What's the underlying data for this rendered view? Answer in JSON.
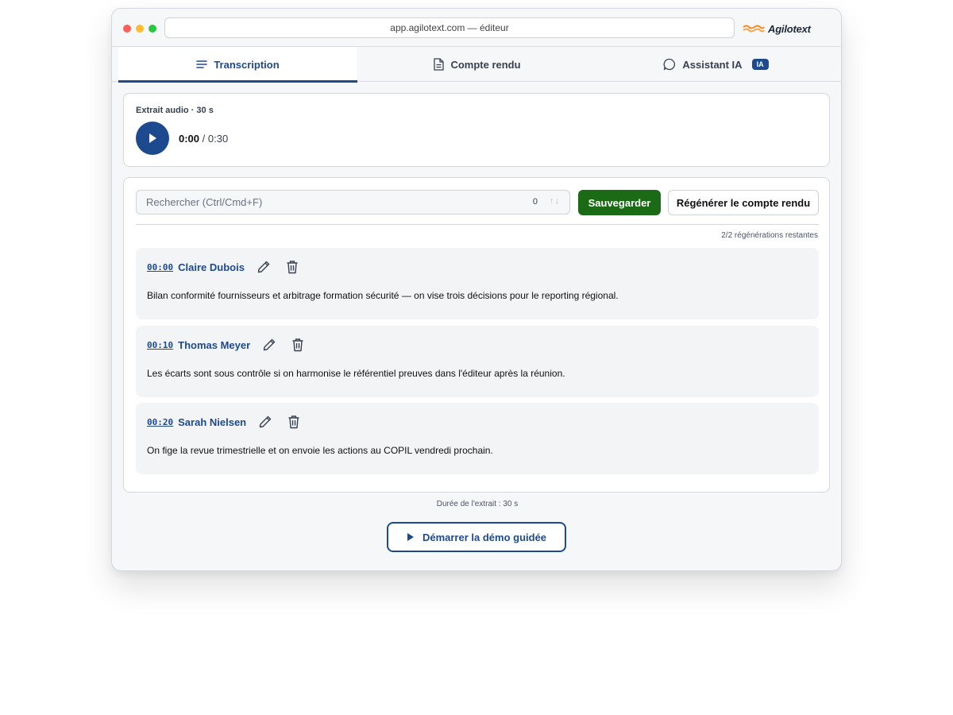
{
  "browser": {
    "url": "app.agilotext.com — éditeur",
    "brand": "Agilotext"
  },
  "tabs": [
    {
      "label": "Transcription",
      "icon": "lines-icon",
      "active": true
    },
    {
      "label": "Compte rendu",
      "icon": "document-icon",
      "active": false
    },
    {
      "label": "Assistant IA",
      "icon": "chat-bubble-icon",
      "badge": "IA",
      "active": false
    }
  ],
  "audio": {
    "label": "Extrait audio · 30 s",
    "current": "0:00",
    "separator": "/",
    "total": "0:30",
    "progress": 0
  },
  "toolbar": {
    "search_placeholder": "Rechercher (Ctrl/Cmd+F)",
    "search_count": "0",
    "search_arrows": "↑↓",
    "save_label": "Sauvegarder",
    "regen_label": "Régénérer le compte rendu",
    "regen_remaining": "2/2 régénérations restantes"
  },
  "segments": [
    {
      "time": "00:00",
      "speaker": "Claire Dubois",
      "text": "Bilan conformité fournisseurs et arbitrage formation sécurité — on vise trois décisions pour le reporting régional."
    },
    {
      "time": "00:10",
      "speaker": "Thomas Meyer",
      "text": "Les écarts sont sous contrôle si on harmonise le référentiel preuves dans l'éditeur après la réunion."
    },
    {
      "time": "00:20",
      "speaker": "Sarah Nielsen",
      "text": "On fige la revue trimestrielle et on envoie les actions au COPIL vendredi prochain."
    }
  ],
  "footer": {
    "duration": "Durée de l'extrait : 30 s",
    "demo_label": "Démarrer la démo guidée"
  },
  "colors": {
    "primary": "#1d4a8f",
    "save": "#1b6b16",
    "brand_orange": "#f08a24"
  }
}
